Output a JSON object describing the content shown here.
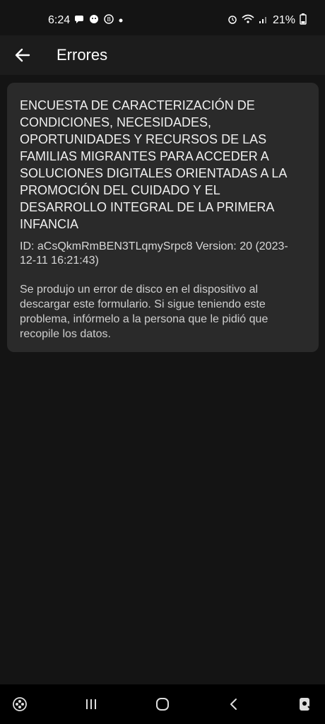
{
  "status": {
    "time": "6:24",
    "battery": "21%"
  },
  "app_bar": {
    "title": "Errores"
  },
  "card": {
    "form_title": "ENCUESTA DE CARACTERIZACIÓN DE CONDICIONES, NECESIDADES, OPORTUNIDADES Y RECURSOS DE LAS FAMILIAS MIGRANTES PARA ACCEDER A SOLUCIONES DIGITALES ORIENTADAS A LA PROMOCIÓN DEL CUIDADO Y EL DESARROLLO INTEGRAL DE LA PRIMERA INFANCIA",
    "meta": "ID: aCsQkmRmBEN3TLqmySrpc8 Version: 20 (2023-12-11 16:21:43)",
    "error_message": "Se produjo un error de disco en el dispositivo al descargar este formulario. Si sigue teniendo este problema, infórmelo a la persona que le pidió que recopile los datos."
  },
  "icons": {
    "back": "back-arrow-icon",
    "game": "game-controller-icon",
    "recents": "recents-icon",
    "home": "home-icon",
    "back_nav": "back-nav-icon",
    "assistant": "assistant-icon"
  },
  "colors": {
    "background": "#141414",
    "app_bar": "#1c1c1c",
    "card": "#2a2a2a",
    "nav_bar": "#000000"
  }
}
